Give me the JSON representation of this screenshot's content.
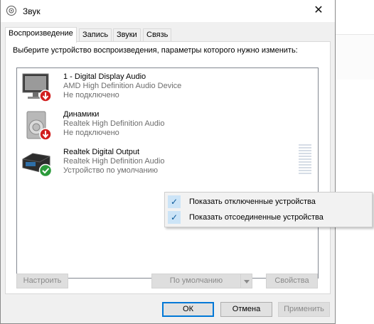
{
  "window": {
    "title": "Звук",
    "close_glyph": "✕"
  },
  "tabs": [
    {
      "label": "Воспроизведение",
      "active": true
    },
    {
      "label": "Запись",
      "active": false
    },
    {
      "label": "Звуки",
      "active": false
    },
    {
      "label": "Связь",
      "active": false
    }
  ],
  "instruction": "Выберите устройство воспроизведения, параметры которого нужно изменить:",
  "devices": [
    {
      "name": "1 - Digital Display Audio",
      "description": "AMD High Definition Audio Device",
      "status": "Не подключено",
      "icon": "monitor-icon",
      "badge": "red-down-arrow"
    },
    {
      "name": "Динамики",
      "description": "Realtek High Definition Audio",
      "status": "Не подключено",
      "icon": "speaker-icon",
      "badge": "red-down-arrow"
    },
    {
      "name": "Realtek Digital Output",
      "description": "Realtek High Definition Audio",
      "status": "Устройство по умолчанию",
      "icon": "digital-output-icon",
      "badge": "green-check"
    }
  ],
  "context_menu": {
    "items": [
      {
        "label": "Показать отключенные устройства",
        "checked": true
      },
      {
        "label": "Показать отсоединенные устройства",
        "checked": true
      }
    ],
    "check_glyph": "✓"
  },
  "panel_buttons": {
    "configure": "Настроить",
    "set_default": "По умолчанию",
    "properties": "Свойства"
  },
  "dialog_buttons": {
    "ok": "ОК",
    "cancel": "Отмена",
    "apply": "Применить"
  },
  "colors": {
    "accent": "#0078d7",
    "disabled_text": "#8a8a8a",
    "badge_red": "#d11e1e",
    "badge_green": "#2a9a3a"
  }
}
